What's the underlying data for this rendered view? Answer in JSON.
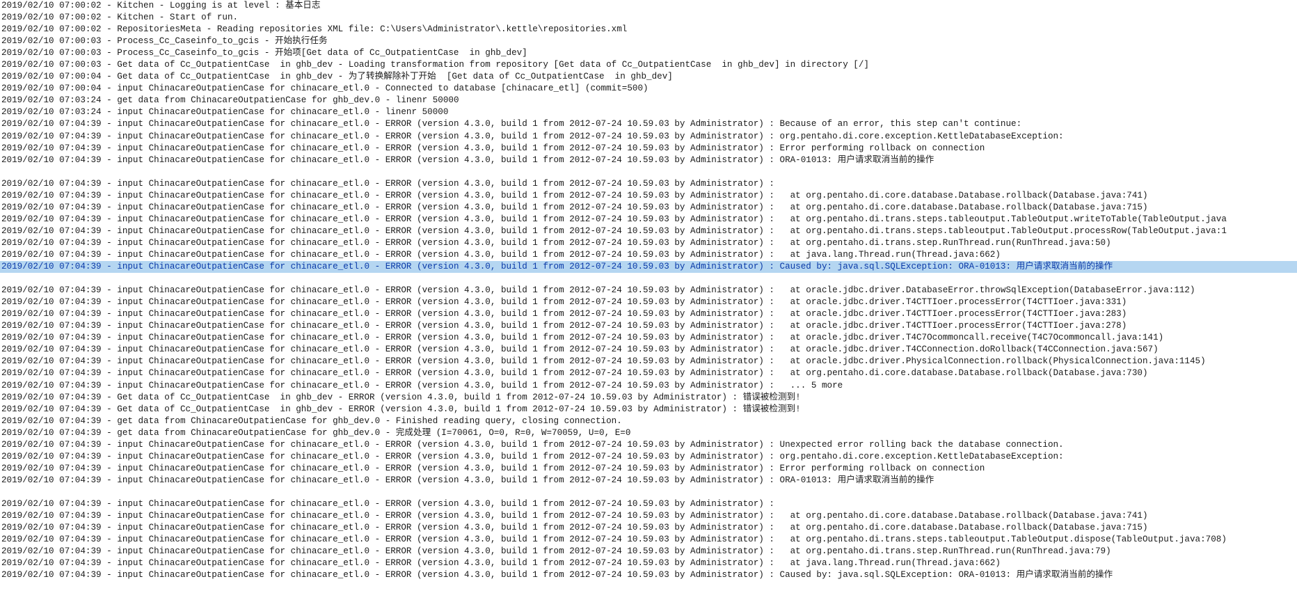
{
  "log": {
    "selected_line_index": 22,
    "lines": [
      "2019/02/10 07:00:02 - Kitchen - Logging is at level : 基本日志",
      "2019/02/10 07:00:02 - Kitchen - Start of run.",
      "2019/02/10 07:00:02 - RepositoriesMeta - Reading repositories XML file: C:\\Users\\Administrator\\.kettle\\repositories.xml",
      "2019/02/10 07:00:03 - Process_Cc_Caseinfo_to_gcis - 开始执行任务",
      "2019/02/10 07:00:03 - Process_Cc_Caseinfo_to_gcis - 开始项[Get data of Cc_OutpatientCase  in ghb_dev]",
      "2019/02/10 07:00:03 - Get data of Cc_OutpatientCase  in ghb_dev - Loading transformation from repository [Get data of Cc_OutpatientCase  in ghb_dev] in directory [/]",
      "2019/02/10 07:00:04 - Get data of Cc_OutpatientCase  in ghb_dev - 为了转换解除补丁开始  [Get data of Cc_OutpatientCase  in ghb_dev]",
      "2019/02/10 07:00:04 - input ChinacareOutpatienCase for chinacare_etl.0 - Connected to database [chinacare_etl] (commit=500)",
      "2019/02/10 07:03:24 - get data from ChinacareOutpatienCase for ghb_dev.0 - linenr 50000",
      "2019/02/10 07:03:24 - input ChinacareOutpatienCase for chinacare_etl.0 - linenr 50000",
      "2019/02/10 07:04:39 - input ChinacareOutpatienCase for chinacare_etl.0 - ERROR (version 4.3.0, build 1 from 2012-07-24 10.59.03 by Administrator) : Because of an error, this step can't continue:",
      "2019/02/10 07:04:39 - input ChinacareOutpatienCase for chinacare_etl.0 - ERROR (version 4.3.0, build 1 from 2012-07-24 10.59.03 by Administrator) : org.pentaho.di.core.exception.KettleDatabaseException:",
      "2019/02/10 07:04:39 - input ChinacareOutpatienCase for chinacare_etl.0 - ERROR (version 4.3.0, build 1 from 2012-07-24 10.59.03 by Administrator) : Error performing rollback on connection",
      "2019/02/10 07:04:39 - input ChinacareOutpatienCase for chinacare_etl.0 - ERROR (version 4.3.0, build 1 from 2012-07-24 10.59.03 by Administrator) : ORA-01013: 用户请求取消当前的操作",
      "",
      "2019/02/10 07:04:39 - input ChinacareOutpatienCase for chinacare_etl.0 - ERROR (version 4.3.0, build 1 from 2012-07-24 10.59.03 by Administrator) :",
      "2019/02/10 07:04:39 - input ChinacareOutpatienCase for chinacare_etl.0 - ERROR (version 4.3.0, build 1 from 2012-07-24 10.59.03 by Administrator) :   at org.pentaho.di.core.database.Database.rollback(Database.java:741)",
      "2019/02/10 07:04:39 - input ChinacareOutpatienCase for chinacare_etl.0 - ERROR (version 4.3.0, build 1 from 2012-07-24 10.59.03 by Administrator) :   at org.pentaho.di.core.database.Database.rollback(Database.java:715)",
      "2019/02/10 07:04:39 - input ChinacareOutpatienCase for chinacare_etl.0 - ERROR (version 4.3.0, build 1 from 2012-07-24 10.59.03 by Administrator) :   at org.pentaho.di.trans.steps.tableoutput.TableOutput.writeToTable(TableOutput.java",
      "2019/02/10 07:04:39 - input ChinacareOutpatienCase for chinacare_etl.0 - ERROR (version 4.3.0, build 1 from 2012-07-24 10.59.03 by Administrator) :   at org.pentaho.di.trans.steps.tableoutput.TableOutput.processRow(TableOutput.java:1",
      "2019/02/10 07:04:39 - input ChinacareOutpatienCase for chinacare_etl.0 - ERROR (version 4.3.0, build 1 from 2012-07-24 10.59.03 by Administrator) :   at org.pentaho.di.trans.step.RunThread.run(RunThread.java:50)",
      "2019/02/10 07:04:39 - input ChinacareOutpatienCase for chinacare_etl.0 - ERROR (version 4.3.0, build 1 from 2012-07-24 10.59.03 by Administrator) :   at java.lang.Thread.run(Thread.java:662)",
      "2019/02/10 07:04:39 - input ChinacareOutpatienCase for chinacare_etl.0 - ERROR (version 4.3.0, build 1 from 2012-07-24 10.59.03 by Administrator) : Caused by: java.sql.SQLException: ORA-01013: 用户请求取消当前的操作",
      "",
      "2019/02/10 07:04:39 - input ChinacareOutpatienCase for chinacare_etl.0 - ERROR (version 4.3.0, build 1 from 2012-07-24 10.59.03 by Administrator) :   at oracle.jdbc.driver.DatabaseError.throwSqlException(DatabaseError.java:112)",
      "2019/02/10 07:04:39 - input ChinacareOutpatienCase for chinacare_etl.0 - ERROR (version 4.3.0, build 1 from 2012-07-24 10.59.03 by Administrator) :   at oracle.jdbc.driver.T4CTTIoer.processError(T4CTTIoer.java:331)",
      "2019/02/10 07:04:39 - input ChinacareOutpatienCase for chinacare_etl.0 - ERROR (version 4.3.0, build 1 from 2012-07-24 10.59.03 by Administrator) :   at oracle.jdbc.driver.T4CTTIoer.processError(T4CTTIoer.java:283)",
      "2019/02/10 07:04:39 - input ChinacareOutpatienCase for chinacare_etl.0 - ERROR (version 4.3.0, build 1 from 2012-07-24 10.59.03 by Administrator) :   at oracle.jdbc.driver.T4CTTIoer.processError(T4CTTIoer.java:278)",
      "2019/02/10 07:04:39 - input ChinacareOutpatienCase for chinacare_etl.0 - ERROR (version 4.3.0, build 1 from 2012-07-24 10.59.03 by Administrator) :   at oracle.jdbc.driver.T4C7Ocommoncall.receive(T4C7Ocommoncall.java:141)",
      "2019/02/10 07:04:39 - input ChinacareOutpatienCase for chinacare_etl.0 - ERROR (version 4.3.0, build 1 from 2012-07-24 10.59.03 by Administrator) :   at oracle.jdbc.driver.T4CConnection.doRollback(T4CConnection.java:567)",
      "2019/02/10 07:04:39 - input ChinacareOutpatienCase for chinacare_etl.0 - ERROR (version 4.3.0, build 1 from 2012-07-24 10.59.03 by Administrator) :   at oracle.jdbc.driver.PhysicalConnection.rollback(PhysicalConnection.java:1145)",
      "2019/02/10 07:04:39 - input ChinacareOutpatienCase for chinacare_etl.0 - ERROR (version 4.3.0, build 1 from 2012-07-24 10.59.03 by Administrator) :   at org.pentaho.di.core.database.Database.rollback(Database.java:730)",
      "2019/02/10 07:04:39 - input ChinacareOutpatienCase for chinacare_etl.0 - ERROR (version 4.3.0, build 1 from 2012-07-24 10.59.03 by Administrator) :   ... 5 more",
      "2019/02/10 07:04:39 - Get data of Cc_OutpatientCase  in ghb_dev - ERROR (version 4.3.0, build 1 from 2012-07-24 10.59.03 by Administrator) : 错误被检测到!",
      "2019/02/10 07:04:39 - Get data of Cc_OutpatientCase  in ghb_dev - ERROR (version 4.3.0, build 1 from 2012-07-24 10.59.03 by Administrator) : 错误被检测到!",
      "2019/02/10 07:04:39 - get data from ChinacareOutpatienCase for ghb_dev.0 - Finished reading query, closing connection.",
      "2019/02/10 07:04:39 - get data from ChinacareOutpatienCase for ghb_dev.0 - 完成处理 (I=70061, O=0, R=0, W=70059, U=0, E=0",
      "2019/02/10 07:04:39 - input ChinacareOutpatienCase for chinacare_etl.0 - ERROR (version 4.3.0, build 1 from 2012-07-24 10.59.03 by Administrator) : Unexpected error rolling back the database connection.",
      "2019/02/10 07:04:39 - input ChinacareOutpatienCase for chinacare_etl.0 - ERROR (version 4.3.0, build 1 from 2012-07-24 10.59.03 by Administrator) : org.pentaho.di.core.exception.KettleDatabaseException:",
      "2019/02/10 07:04:39 - input ChinacareOutpatienCase for chinacare_etl.0 - ERROR (version 4.3.0, build 1 from 2012-07-24 10.59.03 by Administrator) : Error performing rollback on connection",
      "2019/02/10 07:04:39 - input ChinacareOutpatienCase for chinacare_etl.0 - ERROR (version 4.3.0, build 1 from 2012-07-24 10.59.03 by Administrator) : ORA-01013: 用户请求取消当前的操作",
      "",
      "2019/02/10 07:04:39 - input ChinacareOutpatienCase for chinacare_etl.0 - ERROR (version 4.3.0, build 1 from 2012-07-24 10.59.03 by Administrator) :",
      "2019/02/10 07:04:39 - input ChinacareOutpatienCase for chinacare_etl.0 - ERROR (version 4.3.0, build 1 from 2012-07-24 10.59.03 by Administrator) :   at org.pentaho.di.core.database.Database.rollback(Database.java:741)",
      "2019/02/10 07:04:39 - input ChinacareOutpatienCase for chinacare_etl.0 - ERROR (version 4.3.0, build 1 from 2012-07-24 10.59.03 by Administrator) :   at org.pentaho.di.core.database.Database.rollback(Database.java:715)",
      "2019/02/10 07:04:39 - input ChinacareOutpatienCase for chinacare_etl.0 - ERROR (version 4.3.0, build 1 from 2012-07-24 10.59.03 by Administrator) :   at org.pentaho.di.trans.steps.tableoutput.TableOutput.dispose(TableOutput.java:708)",
      "2019/02/10 07:04:39 - input ChinacareOutpatienCase for chinacare_etl.0 - ERROR (version 4.3.0, build 1 from 2012-07-24 10.59.03 by Administrator) :   at org.pentaho.di.trans.step.RunThread.run(RunThread.java:79)",
      "2019/02/10 07:04:39 - input ChinacareOutpatienCase for chinacare_etl.0 - ERROR (version 4.3.0, build 1 from 2012-07-24 10.59.03 by Administrator) :   at java.lang.Thread.run(Thread.java:662)",
      "2019/02/10 07:04:39 - input ChinacareOutpatienCase for chinacare_etl.0 - ERROR (version 4.3.0, build 1 from 2012-07-24 10.59.03 by Administrator) : Caused by: java.sql.SQLException: ORA-01013: 用户请求取消当前的操作"
    ]
  },
  "colors": {
    "background": "#ffffff",
    "text": "#1a1a1a",
    "selection_background": "#b5d6f1",
    "selection_text": "#0b3aa8"
  }
}
